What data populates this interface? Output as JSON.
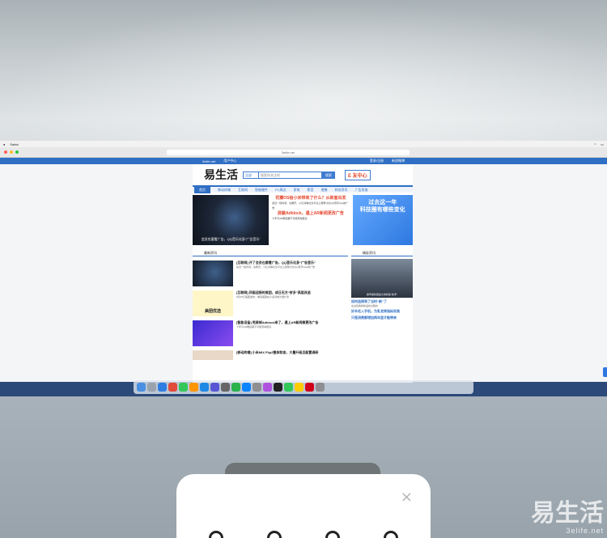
{
  "browser": {
    "url": "3elife.net"
  },
  "site": {
    "logo": "易生活",
    "search_select": "全部",
    "search_placeholder": "搜索你关注的",
    "search_button": "搜索",
    "promo_badge": "E 友中心",
    "topnav": [
      "3elife.net",
      "用户中心",
      "登录/注册",
      "新浪微博"
    ],
    "category_nav": [
      "首页",
      "移动终端",
      "互联网",
      "智能硬件",
      "PC周边",
      "家电",
      "影音",
      "便携",
      "科技资讯",
      "广告投放"
    ],
    "hero": {
      "caption": "会员也要看广告，QQ音乐化身“广告音乐”",
      "headline_1": "花瓣OS给小米带来了什么？从新面出发",
      "headline_2": "屏蔽Adblock，遇上AR新闻更改广告",
      "ad_text_1": "过去这一年",
      "ad_text_2": "科技圈有哪些变化"
    },
    "latest_title": "最新资讯",
    "hot_title": "精彩资讯",
    "items": [
      {
        "title": "[互联网] 开了会员也要看广告，QQ音乐化身“广告音乐”",
        "summary": "最近一段时间，在腾讯、小红书等社交平台上频繁讨论QQ音乐App的广告"
      },
      {
        "title": "[互联网] 四面迎接的美团，成日无方“拼多”高层改选",
        "summary": "8月25日美团发布，看到美团在众多领域大幅扩张"
      },
      {
        "title": "[智能设备] 甩屏掉Adblock来了，遇上AR新闻微更改广告",
        "summary": "十年与AR眼镜都不可能离得很远"
      },
      {
        "title": "[移动终端] 小米MIX Flip2整体取舍，大量升级且配置调研",
        "summary": ""
      }
    ],
    "meituan_label": "美团优选",
    "side_items": [
      {
        "title": "如何选择到了当时“新”了",
        "summary": "在迎接各种新品的过程中"
      },
      {
        "title": "好羊毛入手机，为乳发挥指标实践",
        "summary": ""
      },
      {
        "title": "只是消费都增加两年里才能带来",
        "summary": ""
      }
    ],
    "side_caption": "旗号级机型最大的利和“新手”"
  },
  "sheet": {
    "close_glyph": "×"
  },
  "watermark": {
    "text": "易生活",
    "url": "3elife.net"
  }
}
